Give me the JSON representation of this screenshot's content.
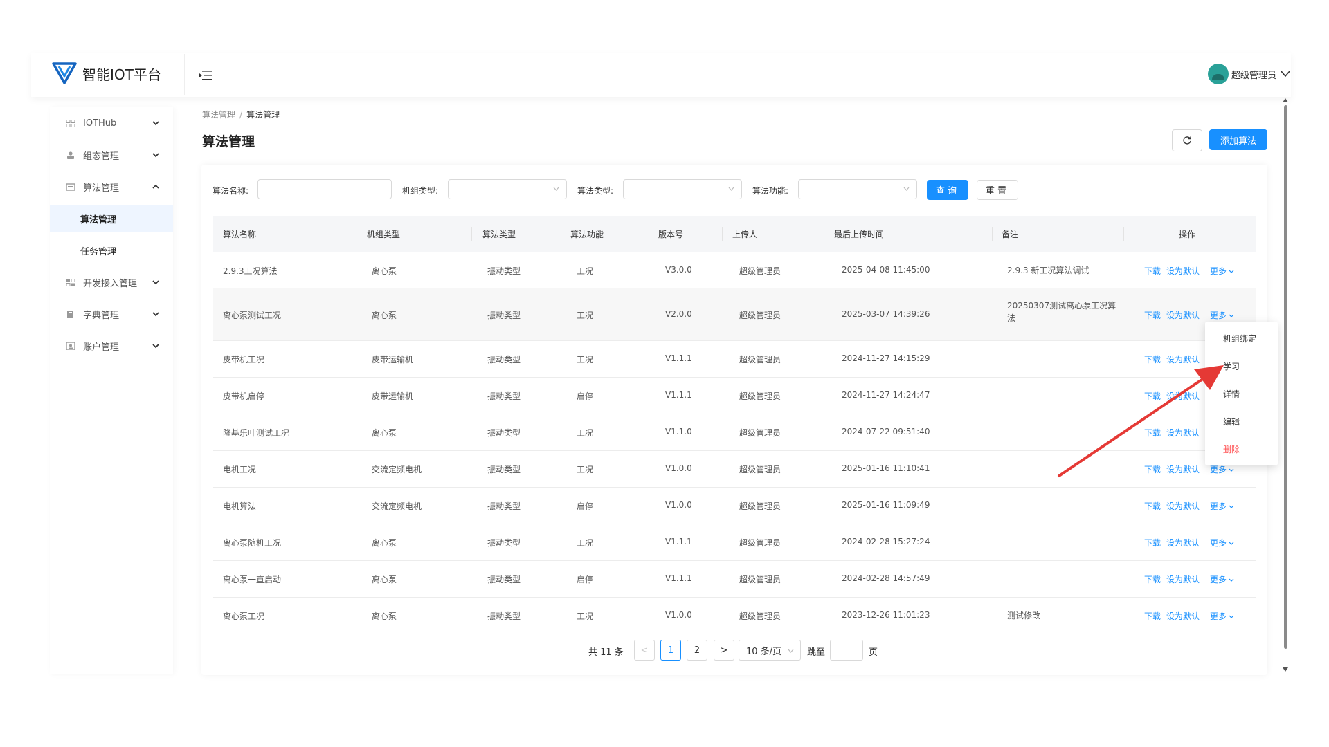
{
  "app": {
    "title": "智能IOT平台"
  },
  "user": {
    "name": "超级管理员"
  },
  "sidebar": {
    "items": [
      {
        "label": "IOTHub",
        "expanded": false
      },
      {
        "label": "组态管理",
        "expanded": false
      },
      {
        "label": "算法管理",
        "expanded": true,
        "children": [
          {
            "label": "算法管理",
            "active": true
          },
          {
            "label": "任务管理",
            "active": false
          }
        ]
      },
      {
        "label": "开发接入管理",
        "expanded": false
      },
      {
        "label": "字典管理",
        "expanded": false
      },
      {
        "label": "账户管理",
        "expanded": false
      }
    ]
  },
  "breadcrumb": {
    "parent": "算法管理",
    "sep": "/",
    "current": "算法管理"
  },
  "page_title": "算法管理",
  "toolbar": {
    "refresh_icon": "refresh-icon",
    "add_label": "添加算法"
  },
  "filters": {
    "name_label": "算法名称:",
    "unit_type_label": "机组类型:",
    "algo_type_label": "算法类型:",
    "algo_func_label": "算法功能:",
    "query_label": "查询",
    "reset_label": "重置"
  },
  "table": {
    "headers": [
      "算法名称",
      "机组类型",
      "算法类型",
      "算法功能",
      "版本号",
      "上传人",
      "最后上传时间",
      "备注",
      "操作"
    ],
    "ops": {
      "download": "下载",
      "set_default": "设为默认",
      "more": "更多"
    },
    "rows": [
      {
        "name": "2.9.3工况算法",
        "unit": "离心泵",
        "type": "振动类型",
        "func": "工况",
        "version": "V3.0.0",
        "uploader": "超级管理员",
        "time": "2025-04-08 11:45:00",
        "remark": "2.9.3 新工况算法调试"
      },
      {
        "name": "离心泵测试工况",
        "unit": "离心泵",
        "type": "振动类型",
        "func": "工况",
        "version": "V2.0.0",
        "uploader": "超级管理员",
        "time": "2025-03-07 14:39:26",
        "remark": "20250307测试离心泵工况算法"
      },
      {
        "name": "皮带机工况",
        "unit": "皮带运输机",
        "type": "振动类型",
        "func": "工况",
        "version": "V1.1.1",
        "uploader": "超级管理员",
        "time": "2024-11-27 14:15:29",
        "remark": ""
      },
      {
        "name": "皮带机启停",
        "unit": "皮带运输机",
        "type": "振动类型",
        "func": "启停",
        "version": "V1.1.1",
        "uploader": "超级管理员",
        "time": "2024-11-27 14:24:47",
        "remark": ""
      },
      {
        "name": "隆基乐叶测试工况",
        "unit": "离心泵",
        "type": "振动类型",
        "func": "工况",
        "version": "V1.1.0",
        "uploader": "超级管理员",
        "time": "2024-07-22 09:51:40",
        "remark": ""
      },
      {
        "name": "电机工况",
        "unit": "交流定频电机",
        "type": "振动类型",
        "func": "工况",
        "version": "V1.0.0",
        "uploader": "超级管理员",
        "time": "2025-01-16 11:10:41",
        "remark": ""
      },
      {
        "name": "电机算法",
        "unit": "交流定频电机",
        "type": "振动类型",
        "func": "启停",
        "version": "V1.0.0",
        "uploader": "超级管理员",
        "time": "2025-01-16 11:09:49",
        "remark": ""
      },
      {
        "name": "离心泵随机工况",
        "unit": "离心泵",
        "type": "振动类型",
        "func": "工况",
        "version": "V1.1.1",
        "uploader": "超级管理员",
        "time": "2024-02-28 15:27:24",
        "remark": ""
      },
      {
        "name": "离心泵一直启动",
        "unit": "离心泵",
        "type": "振动类型",
        "func": "启停",
        "version": "V1.1.1",
        "uploader": "超级管理员",
        "time": "2024-02-28 14:57:49",
        "remark": ""
      },
      {
        "name": "离心泵工况",
        "unit": "离心泵",
        "type": "振动类型",
        "func": "工况",
        "version": "V1.0.0",
        "uploader": "超级管理员",
        "time": "2023-12-26 11:01:23",
        "remark": "测试修改"
      }
    ]
  },
  "more_menu": {
    "items": [
      "机组绑定",
      "学习",
      "详情",
      "编辑",
      "删除"
    ]
  },
  "pagination": {
    "total_label": "共 11 条",
    "pages": [
      "1",
      "2"
    ],
    "current": "1",
    "prev": "<",
    "next": ">",
    "page_size": "10 条/页",
    "jump_label": "跳至",
    "page_unit": "页"
  },
  "colors": {
    "primary": "#1890ff",
    "danger": "#ff4d4f",
    "annotation_arrow": "#e53935"
  }
}
